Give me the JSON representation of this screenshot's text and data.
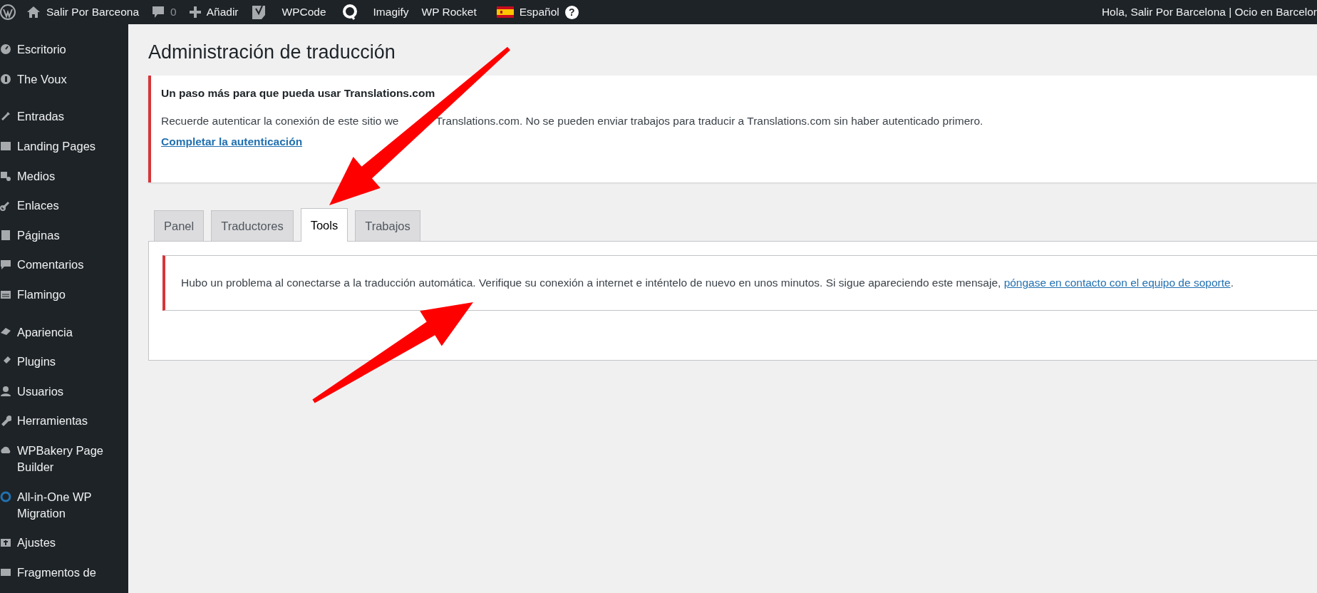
{
  "top_bar": {
    "site": "Salir Por Barceona",
    "comments": "0",
    "new": "Añadir",
    "items": [
      "WPCode",
      "Imagify",
      "WP Rocket"
    ],
    "language": "Español",
    "help_glyph": "?",
    "greeting": "Hola, Salir Por Barcelona | Ocio en Barcelor"
  },
  "sidebar": {
    "groups": [
      [
        {
          "label": "Escritorio"
        },
        {
          "label": "The Voux"
        }
      ],
      [
        {
          "label": "Entradas"
        },
        {
          "label": "Landing Pages"
        },
        {
          "label": "Medios"
        },
        {
          "label": "Enlaces"
        },
        {
          "label": "Páginas"
        },
        {
          "label": "Comentarios"
        },
        {
          "label": "Flamingo"
        }
      ],
      [
        {
          "label": "Apariencia"
        },
        {
          "label": "Plugins"
        },
        {
          "label": "Usuarios"
        },
        {
          "label": "Herramientas"
        },
        {
          "label": "WPBakery Page Builder"
        },
        {
          "label": "All-in-One WP Migration"
        },
        {
          "label": "Ajustes"
        },
        {
          "label": "Fragmentos de"
        }
      ]
    ]
  },
  "page_title": "Administración de traducción",
  "notice": {
    "title": "Un paso más para que pueda usar Translations.com",
    "text_parts": [
      "Recuerde autenticar la conexión de este sitio we",
      "Translations.com. No se pueden enviar trabajos para traducir a Translations.com sin haber autenticado primero."
    ],
    "link": "Completar la autenticación"
  },
  "tabs": [
    {
      "label": "Panel",
      "selected": false
    },
    {
      "label": "Traductores",
      "selected": false
    },
    {
      "label": "Tools",
      "selected": true
    },
    {
      "label": "Trabajos",
      "selected": false
    }
  ],
  "error": {
    "text": "Hubo un problema al conectarse a la traducción automática. Verifique su conexión a internet e inténtelo de nuevo en unos minutos. Si sigue apareciendo este mensaje,",
    "link": "póngase en contacto con el equipo de soporte",
    "end": "."
  }
}
